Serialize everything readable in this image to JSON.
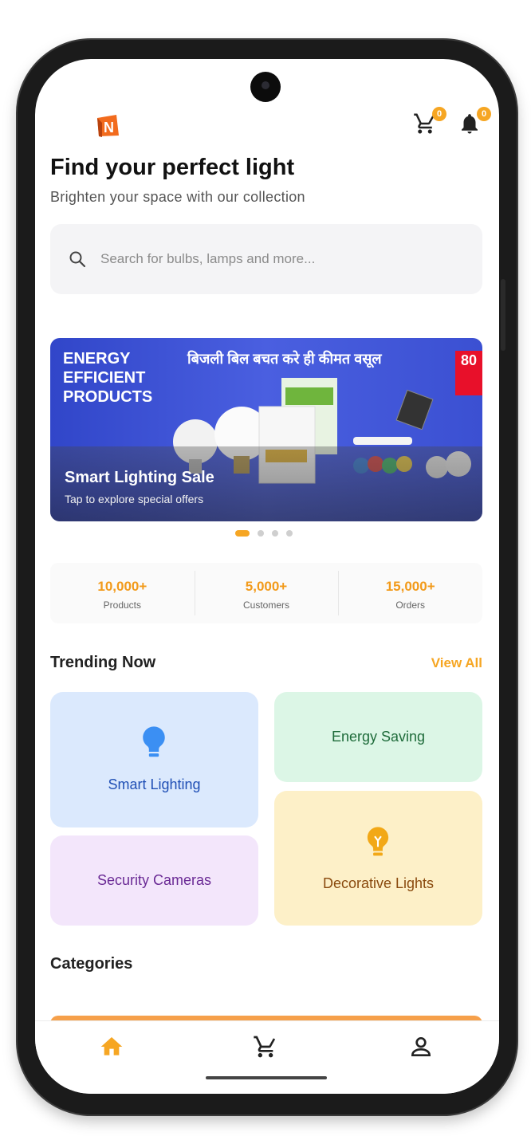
{
  "header": {
    "logo_letter": "N",
    "cart_badge": "0",
    "notif_badge": "0",
    "title": "Find your perfect light",
    "subtitle": "Brighten your space with our collection"
  },
  "search": {
    "placeholder": "Search for bulbs, lamps and more..."
  },
  "banner": {
    "headline_1": "ENERGY",
    "headline_2": "EFFICIENT",
    "headline_3": "PRODUCTS",
    "hindi_text": "बिजली बिल बचत करे ही कीमत वसूल",
    "badge_text": "80",
    "title": "Smart Lighting Sale",
    "subtitle": "Tap to explore special offers",
    "active_slide": 1,
    "slide_count": 4
  },
  "stats": [
    {
      "value": "10,000+",
      "label": "Products"
    },
    {
      "value": "5,000+",
      "label": "Customers"
    },
    {
      "value": "15,000+",
      "label": "Orders"
    }
  ],
  "trending": {
    "title": "Trending Now",
    "view_all": "View All",
    "cards": [
      {
        "label": "Smart Lighting",
        "color": "#dbe9fd",
        "text_color": "#1f4fb5",
        "icon": "lightbulb-icon"
      },
      {
        "label": "Energy Saving",
        "color": "#dcf6e6",
        "text_color": "#1e6b3a"
      },
      {
        "label": "Security Cameras",
        "color": "#f3e6fb",
        "text_color": "#6a2a95"
      },
      {
        "label": "Decorative Lights",
        "color": "#fdf0c8",
        "text_color": "#8a4a0e",
        "icon": "lightbulb-icon"
      }
    ]
  },
  "categories": {
    "title": "Categories"
  },
  "nav": {
    "items": [
      {
        "icon": "home-icon",
        "active": true
      },
      {
        "icon": "cart-icon",
        "active": false
      },
      {
        "icon": "profile-icon",
        "active": false
      }
    ]
  },
  "colors": {
    "accent": "#f6a623",
    "title": "#111111"
  }
}
